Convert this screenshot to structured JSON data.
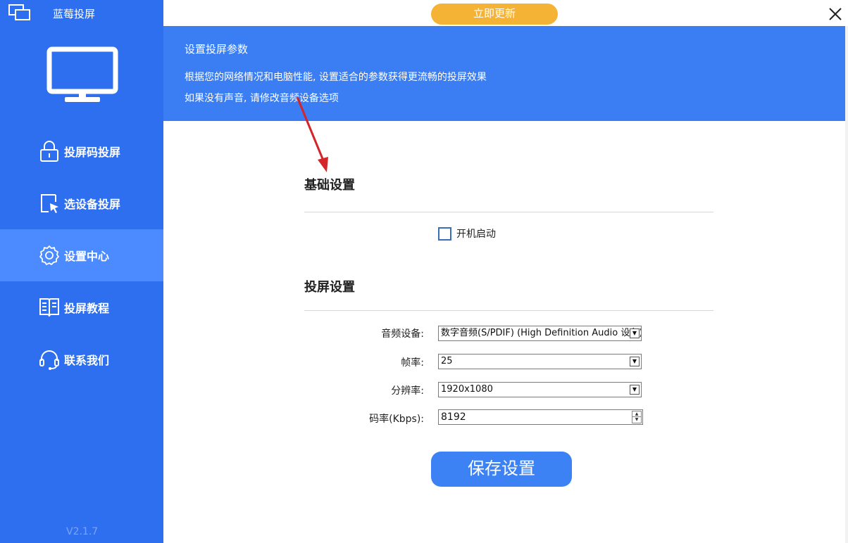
{
  "app": {
    "title": "蓝莓投屏",
    "version": "V2.1.7"
  },
  "sidebar": {
    "items": [
      {
        "label": "投屏码投屏",
        "icon": "lock-icon",
        "active": false
      },
      {
        "label": "选设备投屏",
        "icon": "cursor-select-icon",
        "active": false
      },
      {
        "label": "设置中心",
        "icon": "gear-icon",
        "active": true
      },
      {
        "label": "投屏教程",
        "icon": "book-icon",
        "active": false
      },
      {
        "label": "联系我们",
        "icon": "headset-icon",
        "active": false
      }
    ]
  },
  "header": {
    "update_label": "立即更新"
  },
  "banner": {
    "title": "设置投屏参数",
    "line1": "根据您的网络情况和电脑性能, 设置适合的参数获得更流畅的投屏效果",
    "line2": "如果没有声音, 请修改音频设备选项"
  },
  "basic": {
    "title": "基础设置",
    "autostart_label": "开机启动",
    "autostart_checked": false
  },
  "cast": {
    "title": "投屏设置",
    "audio_label": "音频设备:",
    "audio_value": "数字音频(S/PDIF) (High Definition Audio 设备)",
    "fps_label": "帧率:",
    "fps_value": "25",
    "resolution_label": "分辨率:",
    "resolution_value": "1920x1080",
    "bitrate_label": "码率(Kbps):",
    "bitrate_value": "8192"
  },
  "save_label": "保存设置",
  "colors": {
    "sidebar": "#2e6ff0",
    "sidebar_active": "#4c8bff",
    "banner": "#3b7ef3",
    "update": "#f5b335",
    "save": "#3d82f5"
  }
}
